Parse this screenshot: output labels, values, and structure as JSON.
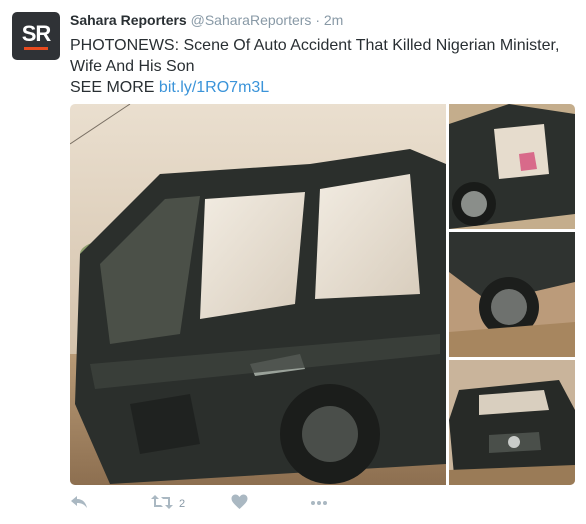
{
  "tweet": {
    "avatar_letters": "SR",
    "author_name": "Sahara Reporters",
    "handle": "@SaharaReporters",
    "separator": "·",
    "timestamp": "2m",
    "text_line1": "PHOTONEWS: Scene Of Auto Accident That Killed Nigerian Minister,",
    "text_line2": "Wife And His Son",
    "see_more_label": "SEE MORE",
    "link_text": "bit.ly/1RO7m3L"
  },
  "actions": {
    "retweet_count": "2"
  },
  "icons": {
    "reply": "reply-icon",
    "retweet": "retweet-icon",
    "like": "heart-icon",
    "more": "more-dots-icon"
  },
  "colors": {
    "brand_accent": "#e94b1f",
    "link": "#3b94d9",
    "muted": "#8899a6",
    "icon": "#aab8c2"
  }
}
